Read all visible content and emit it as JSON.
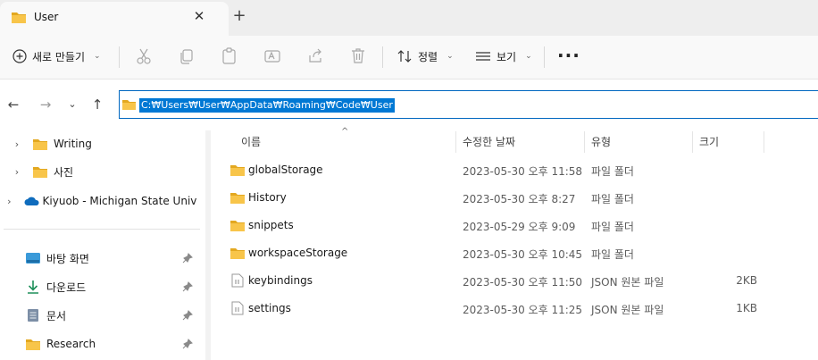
{
  "tab": {
    "title": "User",
    "close_icon": "close-icon",
    "new_tab": "+"
  },
  "toolbar": {
    "new_label": "새로 만들기",
    "sort_label": "정렬",
    "view_label": "보기",
    "more_label": "···"
  },
  "address": {
    "path": "C:₩Users₩User₩AppData₩Roaming₩Code₩User"
  },
  "sidebar": {
    "tree": [
      {
        "label": "Writing"
      },
      {
        "label": "사진"
      },
      {
        "label": "Kiyuob - Michigan State Univer"
      }
    ],
    "quick_access": [
      {
        "label": "바탕 화면"
      },
      {
        "label": "다운로드"
      },
      {
        "label": "문서"
      },
      {
        "label": "Research"
      }
    ]
  },
  "columns": {
    "name": "이름",
    "date": "수정한 날짜",
    "type": "유형",
    "size": "크기"
  },
  "files": [
    {
      "name": "globalStorage",
      "date": "2023-05-30 오후 11:58",
      "type": "파일 폴더",
      "size": ""
    },
    {
      "name": "History",
      "date": "2023-05-30 오후 8:27",
      "type": "파일 폴더",
      "size": ""
    },
    {
      "name": "snippets",
      "date": "2023-05-29 오후 9:09",
      "type": "파일 폴더",
      "size": ""
    },
    {
      "name": "workspaceStorage",
      "date": "2023-05-30 오후 10:45",
      "type": "파일 폴더",
      "size": ""
    },
    {
      "name": "keybindings",
      "date": "2023-05-30 오후 11:50",
      "type": "JSON 원본 파일",
      "size": "2KB"
    },
    {
      "name": "settings",
      "date": "2023-05-30 오후 11:25",
      "type": "JSON 원본 파일",
      "size": "1KB"
    }
  ],
  "colors": {
    "accent": "#0078d4",
    "folder": "#f8c54a",
    "folder_dark": "#e3a820"
  }
}
